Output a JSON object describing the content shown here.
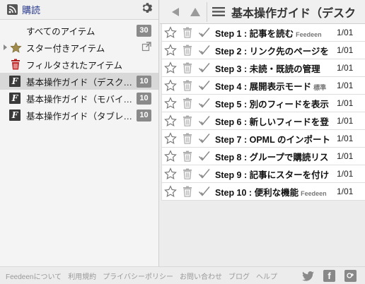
{
  "sidebar": {
    "tab_label": "購読",
    "items": [
      {
        "label": "すべてのアイテム",
        "count": "30",
        "icon": "none"
      },
      {
        "label": "スター付きアイテム",
        "count": "",
        "icon": "star-icon"
      },
      {
        "label": "フィルタされたアイテム",
        "count": "",
        "icon": "trash-icon"
      },
      {
        "label": "基本操作ガイド（デスク…",
        "count": "10",
        "icon": "feedeen-icon"
      },
      {
        "label": "基本操作ガイド（モバイ…",
        "count": "10",
        "icon": "feedeen-icon"
      },
      {
        "label": "基本操作ガイド（タブレ…",
        "count": "10",
        "icon": "feedeen-icon"
      }
    ]
  },
  "main": {
    "title": "基本操作ガイド（デスク",
    "rows": [
      {
        "title": "Step 1 : 記事を読む",
        "source": "Feedeen",
        "date": "1/01"
      },
      {
        "title": "Step 2 : リンク先のページを",
        "source": "",
        "date": "1/01"
      },
      {
        "title": "Step 3 : 未読・既読の管理",
        "source": "",
        "date": "1/01"
      },
      {
        "title": "Step 4 : 展開表示モード",
        "source": "標準",
        "date": "1/01"
      },
      {
        "title": "Step 5 : 別のフィードを表示",
        "source": "",
        "date": "1/01"
      },
      {
        "title": "Step 6 : 新しいフィードを登",
        "source": "",
        "date": "1/01"
      },
      {
        "title": "Step 7 : OPML のインポート",
        "source": "",
        "date": "1/01"
      },
      {
        "title": "Step 8 : グループで購読リス",
        "source": "",
        "date": "1/01"
      },
      {
        "title": "Step 9 : 記事にスターを付け",
        "source": "",
        "date": "1/01"
      },
      {
        "title": "Step 10 : 便利な機能",
        "source": "Feedeen",
        "date": "1/01"
      }
    ]
  },
  "footer": {
    "links": [
      "Feedeenについて",
      "利用規約",
      "プライバシーポリシー",
      "お問い合わせ",
      "ブログ",
      "ヘルプ"
    ],
    "social": [
      "twitter-icon",
      "facebook-icon",
      "google-plus-icon"
    ]
  },
  "colors": {
    "accent": "#2a3b8f",
    "badge": "#8a8a8a",
    "selected": "#d8d8d8"
  }
}
